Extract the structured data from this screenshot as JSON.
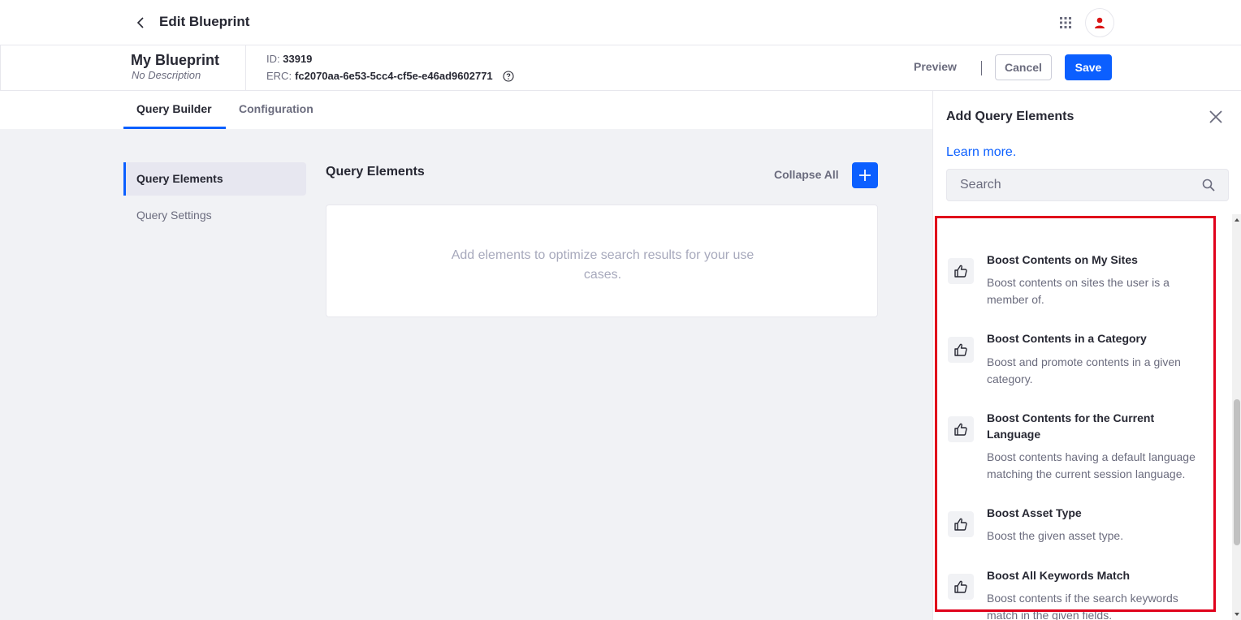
{
  "header": {
    "title": "Edit Blueprint",
    "back_icon": "chevron-left-icon",
    "apps_icon": "grid-icon",
    "avatar_icon": "user-icon"
  },
  "blueprint": {
    "name": "My Blueprint",
    "description": "No Description",
    "id_label": "ID:",
    "id_value": "33919",
    "erc_label": "ERC:",
    "erc_value": "fc2070aa-6e53-5cc4-cf5e-e46ad9602771"
  },
  "actions": {
    "preview": "Preview",
    "cancel": "Cancel",
    "save": "Save"
  },
  "tabs": [
    {
      "label": "Query Builder",
      "active": true
    },
    {
      "label": "Configuration",
      "active": false
    }
  ],
  "nav": [
    {
      "label": "Query Elements",
      "active": true
    },
    {
      "label": "Query Settings",
      "active": false
    }
  ],
  "main": {
    "title": "Query Elements",
    "collapse_all": "Collapse All",
    "empty_message": "Add elements to optimize search results for your use cases."
  },
  "sidebar": {
    "title": "Add Query Elements",
    "learn_more": "Learn more.",
    "search_placeholder": "Search",
    "items": [
      {
        "name": "Boost Contents on My Sites",
        "description": "Boost contents on sites the user is a member of.",
        "icon": "thumbs-up-icon"
      },
      {
        "name": "Boost Contents in a Category",
        "description": "Boost and promote contents in a given category.",
        "icon": "thumbs-up-icon"
      },
      {
        "name": "Boost Contents for the Current Language",
        "description": "Boost contents having a default language matching the current session language.",
        "icon": "thumbs-up-icon"
      },
      {
        "name": "Boost Asset Type",
        "description": "Boost the given asset type.",
        "icon": "thumbs-up-icon"
      },
      {
        "name": "Boost All Keywords Match",
        "description": "Boost contents if the search keywords match in the given fields.",
        "icon": "thumbs-up-icon"
      }
    ]
  },
  "colors": {
    "primary": "#0b5fff",
    "highlight": "#e0001b",
    "text": "#272833",
    "muted": "#6b6c7e"
  }
}
